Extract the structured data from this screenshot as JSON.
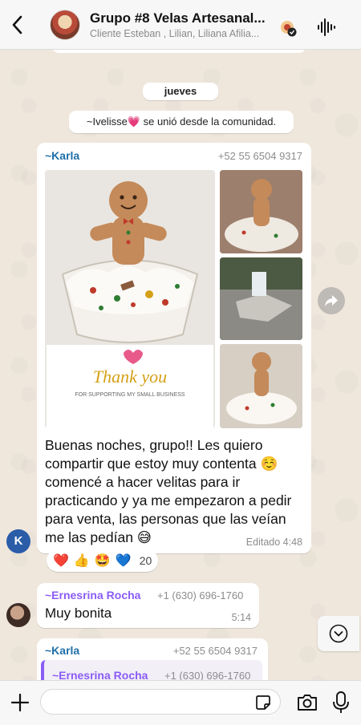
{
  "header": {
    "title": "Grupo #8 Velas Artesanal...",
    "subtitle": "Cliente Esteban , Lilian, Liliana Afilia..."
  },
  "chat": {
    "day_label": "jueves",
    "system_message": "~Ivelisse💗 se unió desde la comunidad.",
    "messages": [
      {
        "sender": "~Karla",
        "sender_color": "#1f6fa8",
        "phone": "+52 55 6504 9317",
        "avatar_letter": "K",
        "photo_caption_title": "Thank you",
        "photo_caption_sub": "FOR SUPPORTING MY SMALL BUSINESS",
        "text": "Buenas noches, grupo!! Les quiero compartir que estoy muy contenta ☺️ comencé a hacer velitas para ir practicando y ya me empezaron a pedir para venta, las personas que las veían me las pedían 😅",
        "time": "Editado 4:48",
        "reactions": [
          "❤️",
          "👍",
          "🤩",
          "💙"
        ],
        "reaction_count": "20"
      },
      {
        "sender": "~Ernesrina Rocha",
        "sender_color": "#8b5cf6",
        "phone": "+1 (630) 696-1760",
        "text": "Muy bonita",
        "time": "5:14"
      },
      {
        "sender": "~Karla",
        "sender_color": "#1f6fa8",
        "phone": "+52 55 6504 9317",
        "quote_sender": "~Ernesrina Rocha",
        "quote_phone": "+1 (630) 696-1760"
      }
    ]
  },
  "icons": {
    "back": "chevron-left-icon",
    "voice": "waveform-icon",
    "community": "community-badge-icon",
    "forward": "share-icon",
    "scroll": "chevron-down-circle-icon",
    "attach": "plus-icon",
    "sticker": "sticker-icon",
    "camera": "camera-icon",
    "mic": "microphone-icon"
  }
}
